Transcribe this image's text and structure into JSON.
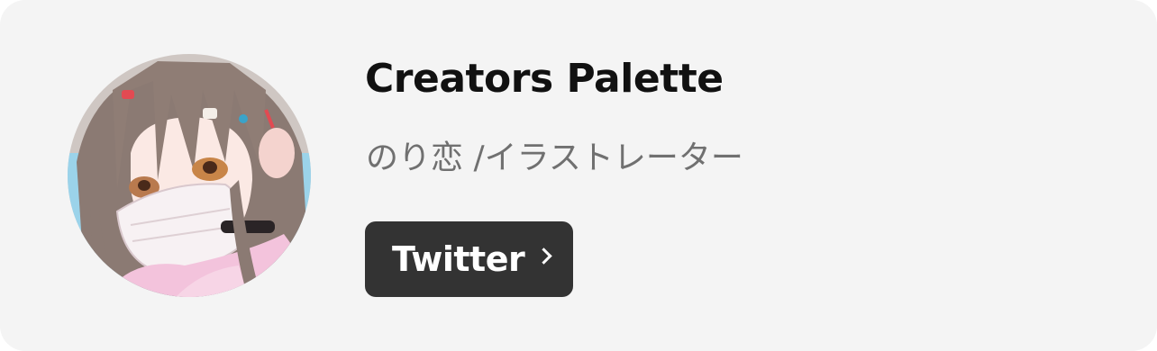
{
  "profile": {
    "name": "Creators Palette",
    "role": "のり恋 /イラストレーター",
    "avatar_icon": "illustrated-character-avatar",
    "button_label": "Twitter",
    "button_icon": "chevron-right-icon"
  },
  "colors": {
    "card_background": "#f4f4f4",
    "name_text": "#111111",
    "role_text": "#707070",
    "button_background": "#333333",
    "button_text": "#ffffff"
  }
}
